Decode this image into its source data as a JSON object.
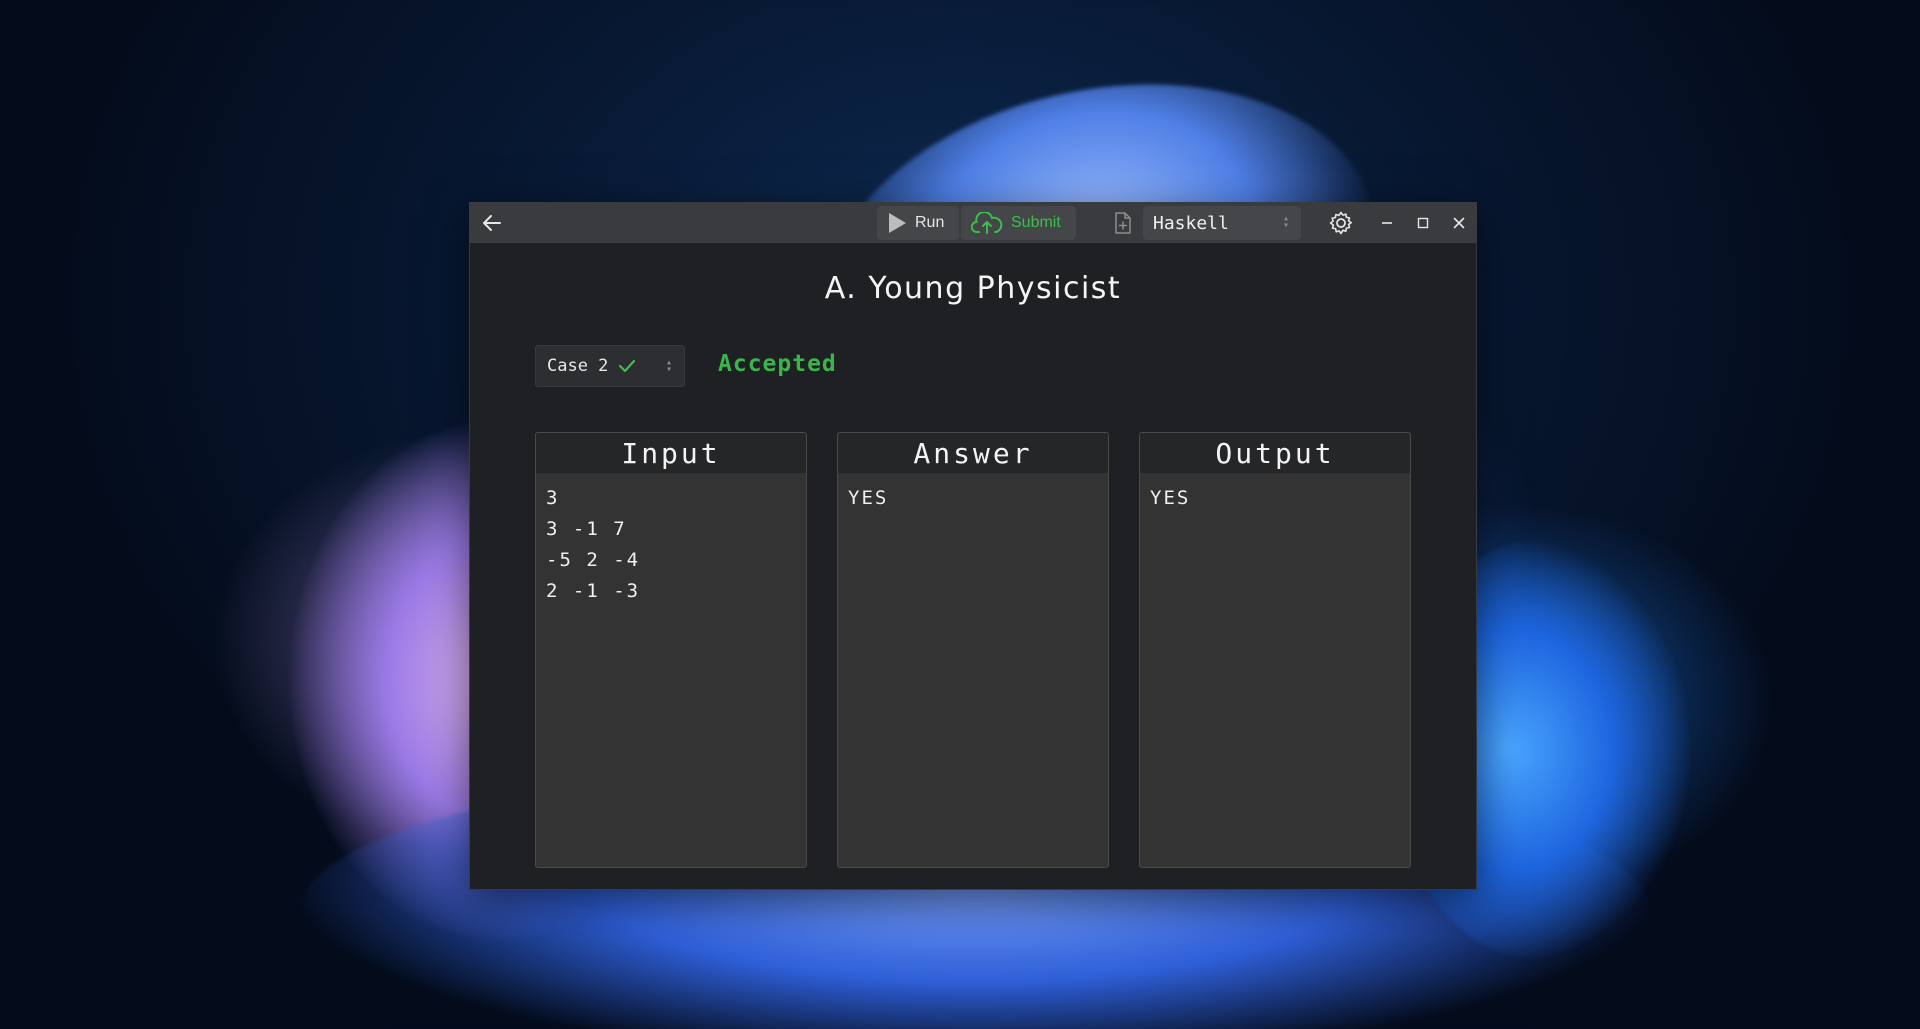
{
  "window": {
    "run_label": "Run",
    "submit_label": "Submit",
    "language": "Haskell"
  },
  "problem": {
    "title": "A. Young Physicist"
  },
  "case": {
    "label": "Case 2",
    "verdict": "Accepted"
  },
  "panels": {
    "input": {
      "title": "Input",
      "lines": [
        "3",
        "3 -1 7",
        "-5 2 -4",
        "2 -1 -3"
      ]
    },
    "answer": {
      "title": "Answer",
      "lines": [
        "YES"
      ]
    },
    "output": {
      "title": "Output",
      "lines": [
        "YES"
      ]
    }
  },
  "colors": {
    "accent_green": "#39b54a",
    "titlebar": "#3a3b3e",
    "window_bg": "#1f2023",
    "panel_bg": "#333333"
  }
}
